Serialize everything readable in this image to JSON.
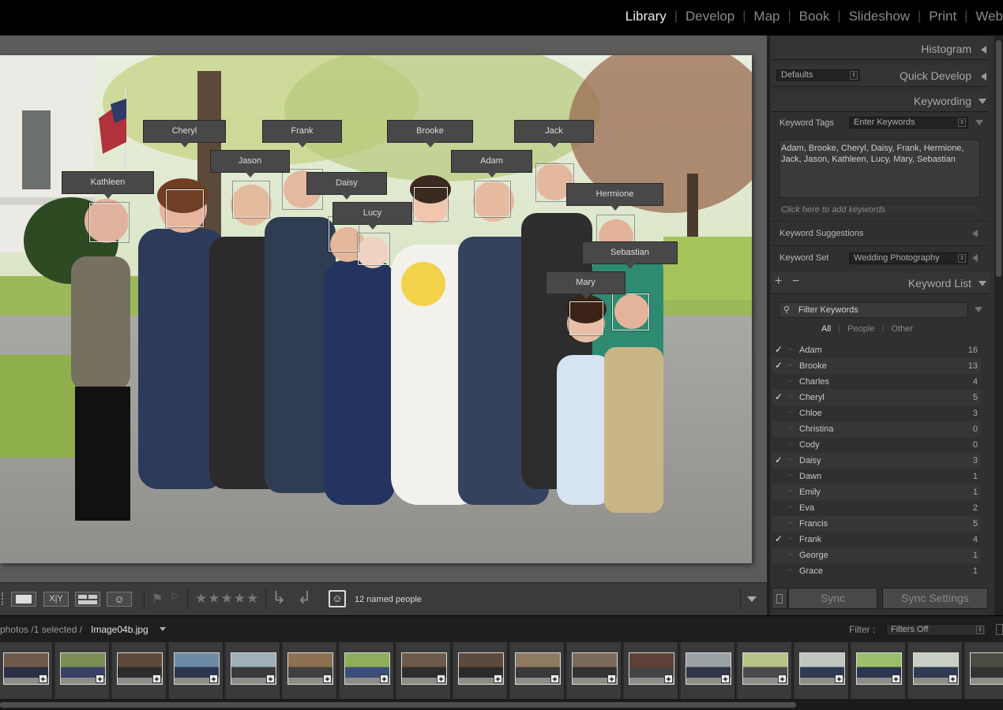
{
  "modules": [
    "Library",
    "Develop",
    "Map",
    "Book",
    "Slideshow",
    "Print",
    "Web"
  ],
  "active_module": "Library",
  "photo": {
    "face_tags": [
      "Kathleen",
      "Cheryl",
      "Jason",
      "Frank",
      "Daisy",
      "Lucy",
      "Brooke",
      "Adam",
      "Jack",
      "Hermione",
      "Sebastian",
      "Mary"
    ]
  },
  "right_panel": {
    "histogram_title": "Histogram",
    "quick_develop_title": "Quick Develop",
    "quick_develop_preset": "Defaults",
    "keywording_title": "Keywording",
    "keyword_tags_label": "Keyword Tags",
    "keyword_tags_mode": "Enter Keywords",
    "keywords_text": "Adam, Brooke, Cheryl, Daisy, Frank, Hermione, Jack, Jason, Kathleen, Lucy, Mary, Sebastian",
    "add_keywords_placeholder": "Click here to add keywords",
    "keyword_suggestions_label": "Keyword Suggestions",
    "keyword_set_label": "Keyword Set",
    "keyword_set_value": "Wedding Photography",
    "plus_label": "+",
    "minus_label": "−",
    "keyword_list_title": "Keyword List",
    "filter_placeholder": "Filter Keywords",
    "filter_tabs": [
      "All",
      "People",
      "Other"
    ],
    "active_filter_tab": "All",
    "keywords": [
      {
        "name": "Adam",
        "count": "16",
        "checked": true
      },
      {
        "name": "Brooke",
        "count": "13",
        "checked": true
      },
      {
        "name": "Charles",
        "count": "4",
        "checked": false
      },
      {
        "name": "Cheryl",
        "count": "5",
        "checked": true
      },
      {
        "name": "Chloe",
        "count": "3",
        "checked": false
      },
      {
        "name": "Christina",
        "count": "0",
        "checked": false
      },
      {
        "name": "Cody",
        "count": "0",
        "checked": false
      },
      {
        "name": "Daisy",
        "count": "3",
        "checked": true
      },
      {
        "name": "Dawn",
        "count": "1",
        "checked": false
      },
      {
        "name": "Emily",
        "count": "1",
        "checked": false
      },
      {
        "name": "Eva",
        "count": "2",
        "checked": false
      },
      {
        "name": "Francis",
        "count": "5",
        "checked": false
      },
      {
        "name": "Frank",
        "count": "4",
        "checked": true
      },
      {
        "name": "George",
        "count": "1",
        "checked": false
      },
      {
        "name": "Grace",
        "count": "1",
        "checked": false
      }
    ],
    "sync_label": "Sync",
    "sync_settings_label": "Sync Settings"
  },
  "toolbar": {
    "rating_stars": "★★★★★",
    "people_status": "12 named people"
  },
  "filmstrip_header": {
    "path_prefix": "photos /1 selected /",
    "filename": "Image04b.jpg",
    "filter_label": "Filter :",
    "filter_value": "Filters Off"
  },
  "colors": {
    "accent_text": "#ececec",
    "panel_bg": "#303030",
    "view_bg": "#5b5b5b"
  }
}
